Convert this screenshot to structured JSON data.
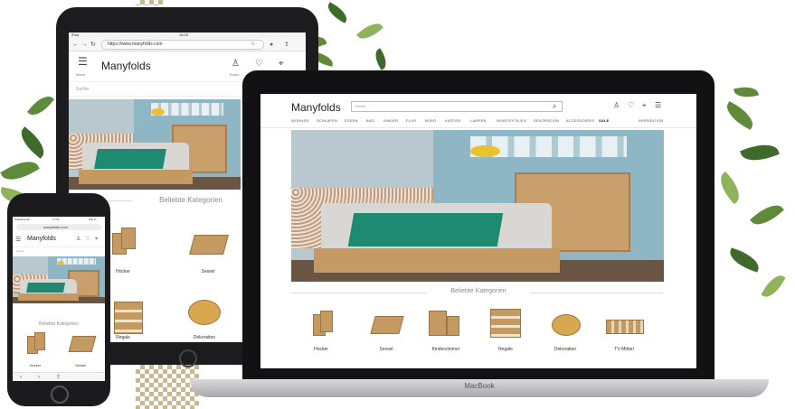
{
  "tablet": {
    "status_left": "iPad",
    "status_time": "15:25",
    "url": "https://www.manyfolds.com",
    "menu_label": "Menu",
    "logo": "Manyfolds",
    "account_label": "Konto",
    "search_placeholder": "Suche",
    "section_title": "Beliebte Kategorien",
    "categories": [
      "Hocker",
      "Sessel",
      "Regale",
      "Dekoration"
    ]
  },
  "phone": {
    "carrier": "Vodafone.de",
    "time": "17:21",
    "battery": "100 %",
    "url": "manyfolds.com",
    "logo": "Manyfolds",
    "search_placeholder": "Suche",
    "section_title": "Beliebte Kategorien",
    "categories": [
      "Hocker",
      "Sessel"
    ]
  },
  "laptop": {
    "logo": "Manyfolds",
    "search_placeholder": "Suche",
    "nav": [
      "WOHNEN",
      "SCHLAFEN",
      "ESSEN",
      "BAD",
      "KINDER",
      "FLUR",
      "BÜRO",
      "KARTEN",
      "LAMPEN",
      "HEIMTEXTILIEN",
      "DEKORATION",
      "ACCESSOIRES",
      "SALE",
      "INSPIRATION"
    ],
    "section_title": "Beliebte Kategorien",
    "categories": [
      "Hocker",
      "Sessel",
      "Kinderzimmer",
      "Regale",
      "Dekoration",
      "TV-Möbel"
    ],
    "brand_label": "MacBook"
  },
  "icons": [
    "search-icon",
    "user-icon",
    "heart-icon",
    "location-icon",
    "menu-icon",
    "share-icon",
    "reload-icon",
    "star-icon",
    "microphone-icon",
    "back-icon",
    "forward-icon"
  ]
}
